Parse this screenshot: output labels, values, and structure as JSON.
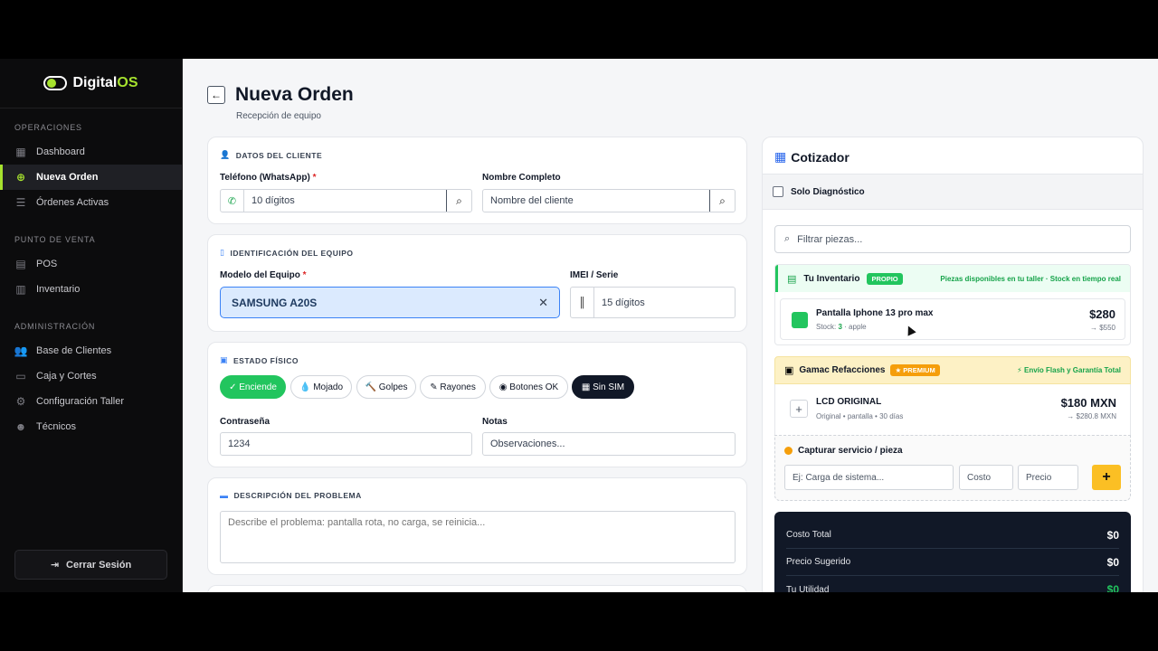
{
  "brand": {
    "name_prefix": "Digital",
    "name_suffix": "OS"
  },
  "sidebar": {
    "sections": [
      {
        "label": "OPERACIONES",
        "items": [
          {
            "label": "Dashboard",
            "icon": "grid-icon"
          },
          {
            "label": "Nueva Orden",
            "icon": "plus-circle-icon",
            "active": true
          },
          {
            "label": "Órdenes Activas",
            "icon": "list-icon"
          }
        ]
      },
      {
        "label": "PUNTO DE VENTA",
        "items": [
          {
            "label": "POS",
            "icon": "register-icon"
          },
          {
            "label": "Inventario",
            "icon": "boxes-icon"
          }
        ]
      },
      {
        "label": "ADMINISTRACIÓN",
        "items": [
          {
            "label": "Base de Clientes",
            "icon": "users-icon"
          },
          {
            "label": "Caja y Cortes",
            "icon": "cashbox-icon"
          },
          {
            "label": "Configuración Taller",
            "icon": "gear-icon"
          },
          {
            "label": "Técnicos",
            "icon": "team-icon"
          }
        ]
      }
    ],
    "logout": "Cerrar Sesión"
  },
  "header": {
    "title": "Nueva Orden",
    "subtitle": "Recepción de equipo"
  },
  "cliente": {
    "section_title": "DATOS DEL CLIENTE",
    "phone_label": "Teléfono (WhatsApp)",
    "phone_placeholder": "10 dígitos",
    "name_label": "Nombre Completo",
    "name_placeholder": "Nombre del cliente"
  },
  "equipo": {
    "section_title": "IDENTIFICACIÓN DEL EQUIPO",
    "model_label": "Modelo del Equipo",
    "model_value": "SAMSUNG A20S",
    "imei_label": "IMEI / Serie",
    "imei_placeholder": "15 dígitos"
  },
  "estado": {
    "section_title": "ESTADO FÍSICO",
    "chips": [
      {
        "label": "✓ Enciende",
        "state": "on"
      },
      {
        "label": "💧 Mojado",
        "state": "off"
      },
      {
        "label": "🔨 Golpes",
        "state": "off"
      },
      {
        "label": "✎ Rayones",
        "state": "off"
      },
      {
        "label": "◉ Botones OK",
        "state": "off"
      },
      {
        "label": "▦ Sin SIM",
        "state": "dark"
      }
    ],
    "password_label": "Contraseña",
    "password_value": "1234",
    "notes_label": "Notas",
    "notes_placeholder": "Observaciones..."
  },
  "problema": {
    "section_title": "DESCRIPCIÓN DEL PROBLEMA",
    "placeholder": "Describe el problema: pantalla rota, no carga, se reinicia..."
  },
  "cotizador": {
    "title": "Cotizador",
    "diagnostic_label": "Solo Diagnóstico",
    "filter_placeholder": "Filtrar piezas...",
    "inventory": {
      "title": "Tu Inventario",
      "badge": "PROPIO",
      "note": "Piezas disponibles en tu taller · Stock en tiempo real",
      "item": {
        "name": "Pantalla Iphone 13 pro max",
        "stock_label": "Stock:",
        "stock": "3",
        "brand": "· apple",
        "price": "$280",
        "suggested": "→ $550"
      }
    },
    "gamac": {
      "title": "Gamac Refacciones",
      "badge": "★ PREMIUM",
      "note": "⚡ Envío Flash y Garantía Total",
      "item": {
        "name": "LCD ORIGINAL",
        "meta": "Original • pantalla • 30 días",
        "price": "$180 MXN",
        "suggested": "→ $280.8 MXN"
      }
    },
    "capture": {
      "title": "Capturar servicio / pieza",
      "desc_placeholder": "Ej: Carga de sistema...",
      "cost_placeholder": "Costo",
      "price_placeholder": "Precio"
    },
    "totals": [
      {
        "label": "Costo Total",
        "value": "$0"
      },
      {
        "label": "Precio Sugerido",
        "value": "$0"
      },
      {
        "label": "Tu Utilidad",
        "value": "$0"
      }
    ]
  },
  "colors": {
    "accent": "#a6e22e",
    "primary": "#3b82f6",
    "success": "#22c55e",
    "warning": "#fbbf24"
  }
}
